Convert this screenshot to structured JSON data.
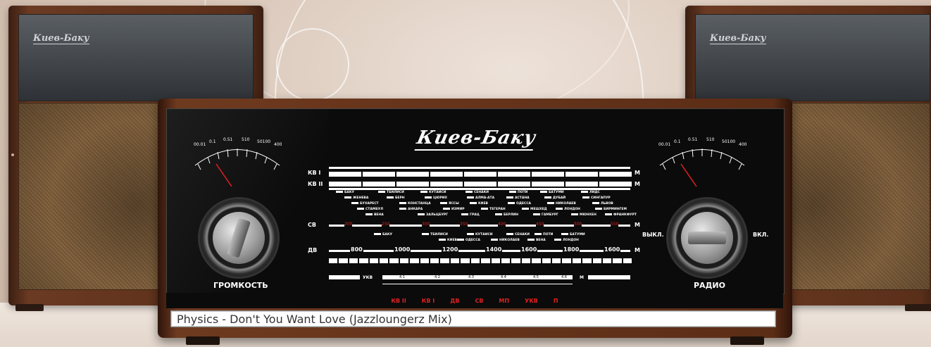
{
  "radio": {
    "brand": "Киев-Баку",
    "volume_label": "ГРОМКОСТЬ",
    "power_label": "РАДИО",
    "off_label": "ВЫКЛ.",
    "on_label": "ВКЛ.",
    "bands": [
      "КВ I",
      "КВ II",
      "СВ",
      "ДВ"
    ],
    "band_suffix": "М",
    "sv_numbers": [
      "200",
      "250",
      "300",
      "350",
      "400",
      "450",
      "500",
      "550"
    ],
    "dv_numbers": [
      "800",
      "1000",
      "1200",
      "1400",
      "1600",
      "1800",
      "1600"
    ],
    "ukv_label": "УКВ",
    "ukv_numbers": [
      "4.1",
      "4.2",
      "4.3",
      "4.4",
      "4.5",
      "4.6",
      "М"
    ],
    "cities_row1": [
      "БАКУ",
      "ТБИЛИСИ",
      "КУТАИСИ",
      "СЕНАКИ",
      "ПОТИ",
      "БАТУМИ",
      "ЛИДС"
    ],
    "cities_row2": [
      "ЖЕНЕВА",
      "БЕРН",
      "ЦЮРИХ",
      "АЛМА-АТА",
      "АСТАНА",
      "ДУБАЙ",
      "СИНГАПУР"
    ],
    "cities_row3": [
      "БУХАРЕСТ",
      "КОНСТАНЦА",
      "ЯССЫ",
      "КИЕВ",
      "ОДЕССА",
      "НИКОЛАЕВ",
      "ЛЬВОВ"
    ],
    "cities_row4": [
      "СТАМБУЛ",
      "АНКАРА",
      "ИЗМИР",
      "ТЕГЕРАН",
      "МЕШХЕД",
      "ЛОНДОН",
      "БИРМИНГЕМ"
    ],
    "cities_row5": [
      "ВЕНА",
      "ЗАЛЬЦБУРГ",
      "ГРАЦ",
      "БЕРЛИН",
      "ГАМБУРГ",
      "МЮНХЕН",
      "ФРАНКФУРТ"
    ],
    "cities_row6": [
      "БАКУ",
      "ТБИЛИСИ",
      "КУТАИСИ",
      "СЕНАКИ",
      "ПОТИ",
      "БАТУМИ"
    ],
    "cities_row7": [
      "КИЕВ",
      "ОДЕССА",
      "НИКОЛАЕВ",
      "ВЕНА",
      "ЛОНДОН"
    ],
    "meter_ticks": [
      "00.01",
      "0.1",
      "0.51",
      "510",
      "50100",
      "400"
    ],
    "band_buttons": [
      "КВ II",
      "КВ I",
      "ДВ",
      "СВ",
      "МП",
      "УКВ",
      "П"
    ],
    "now_playing": "Physics - Don't You Want Love (Jazzloungerz Mix)"
  },
  "speakers": {
    "brand": "Киев-Баку"
  },
  "colors": {
    "accent_red": "#e02020",
    "wood": "#5c2d16",
    "panel": "#0b0b0b"
  }
}
